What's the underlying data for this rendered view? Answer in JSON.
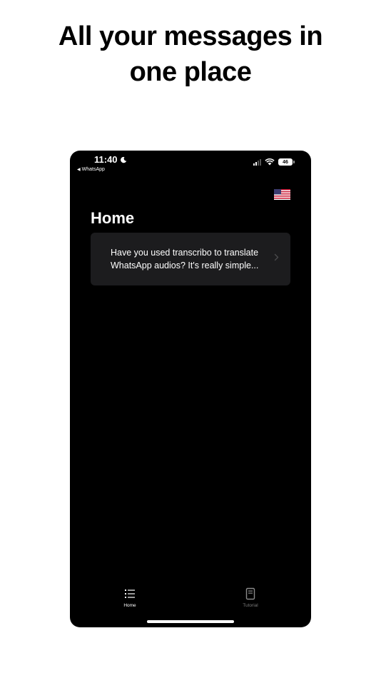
{
  "headline": {
    "line1": "All your messages in",
    "line2": "one place"
  },
  "status_bar": {
    "time": "11:40",
    "back_app": "WhatsApp",
    "battery": "46"
  },
  "header": {
    "title": "Home",
    "language_flag": "us-flag-icon"
  },
  "card": {
    "text": "Have you used transcribo to translate WhatsApp audios? It's really simple..."
  },
  "tabs": [
    {
      "label": "Home",
      "icon": "list-icon",
      "active": true
    },
    {
      "label": "Tutorial",
      "icon": "book-icon",
      "active": false
    }
  ],
  "colors": {
    "background": "#ffffff",
    "phone_screen": "#000000",
    "card": "#1c1c1e",
    "text": "#ffffff",
    "inactive_tab": "#7a7a7a"
  }
}
